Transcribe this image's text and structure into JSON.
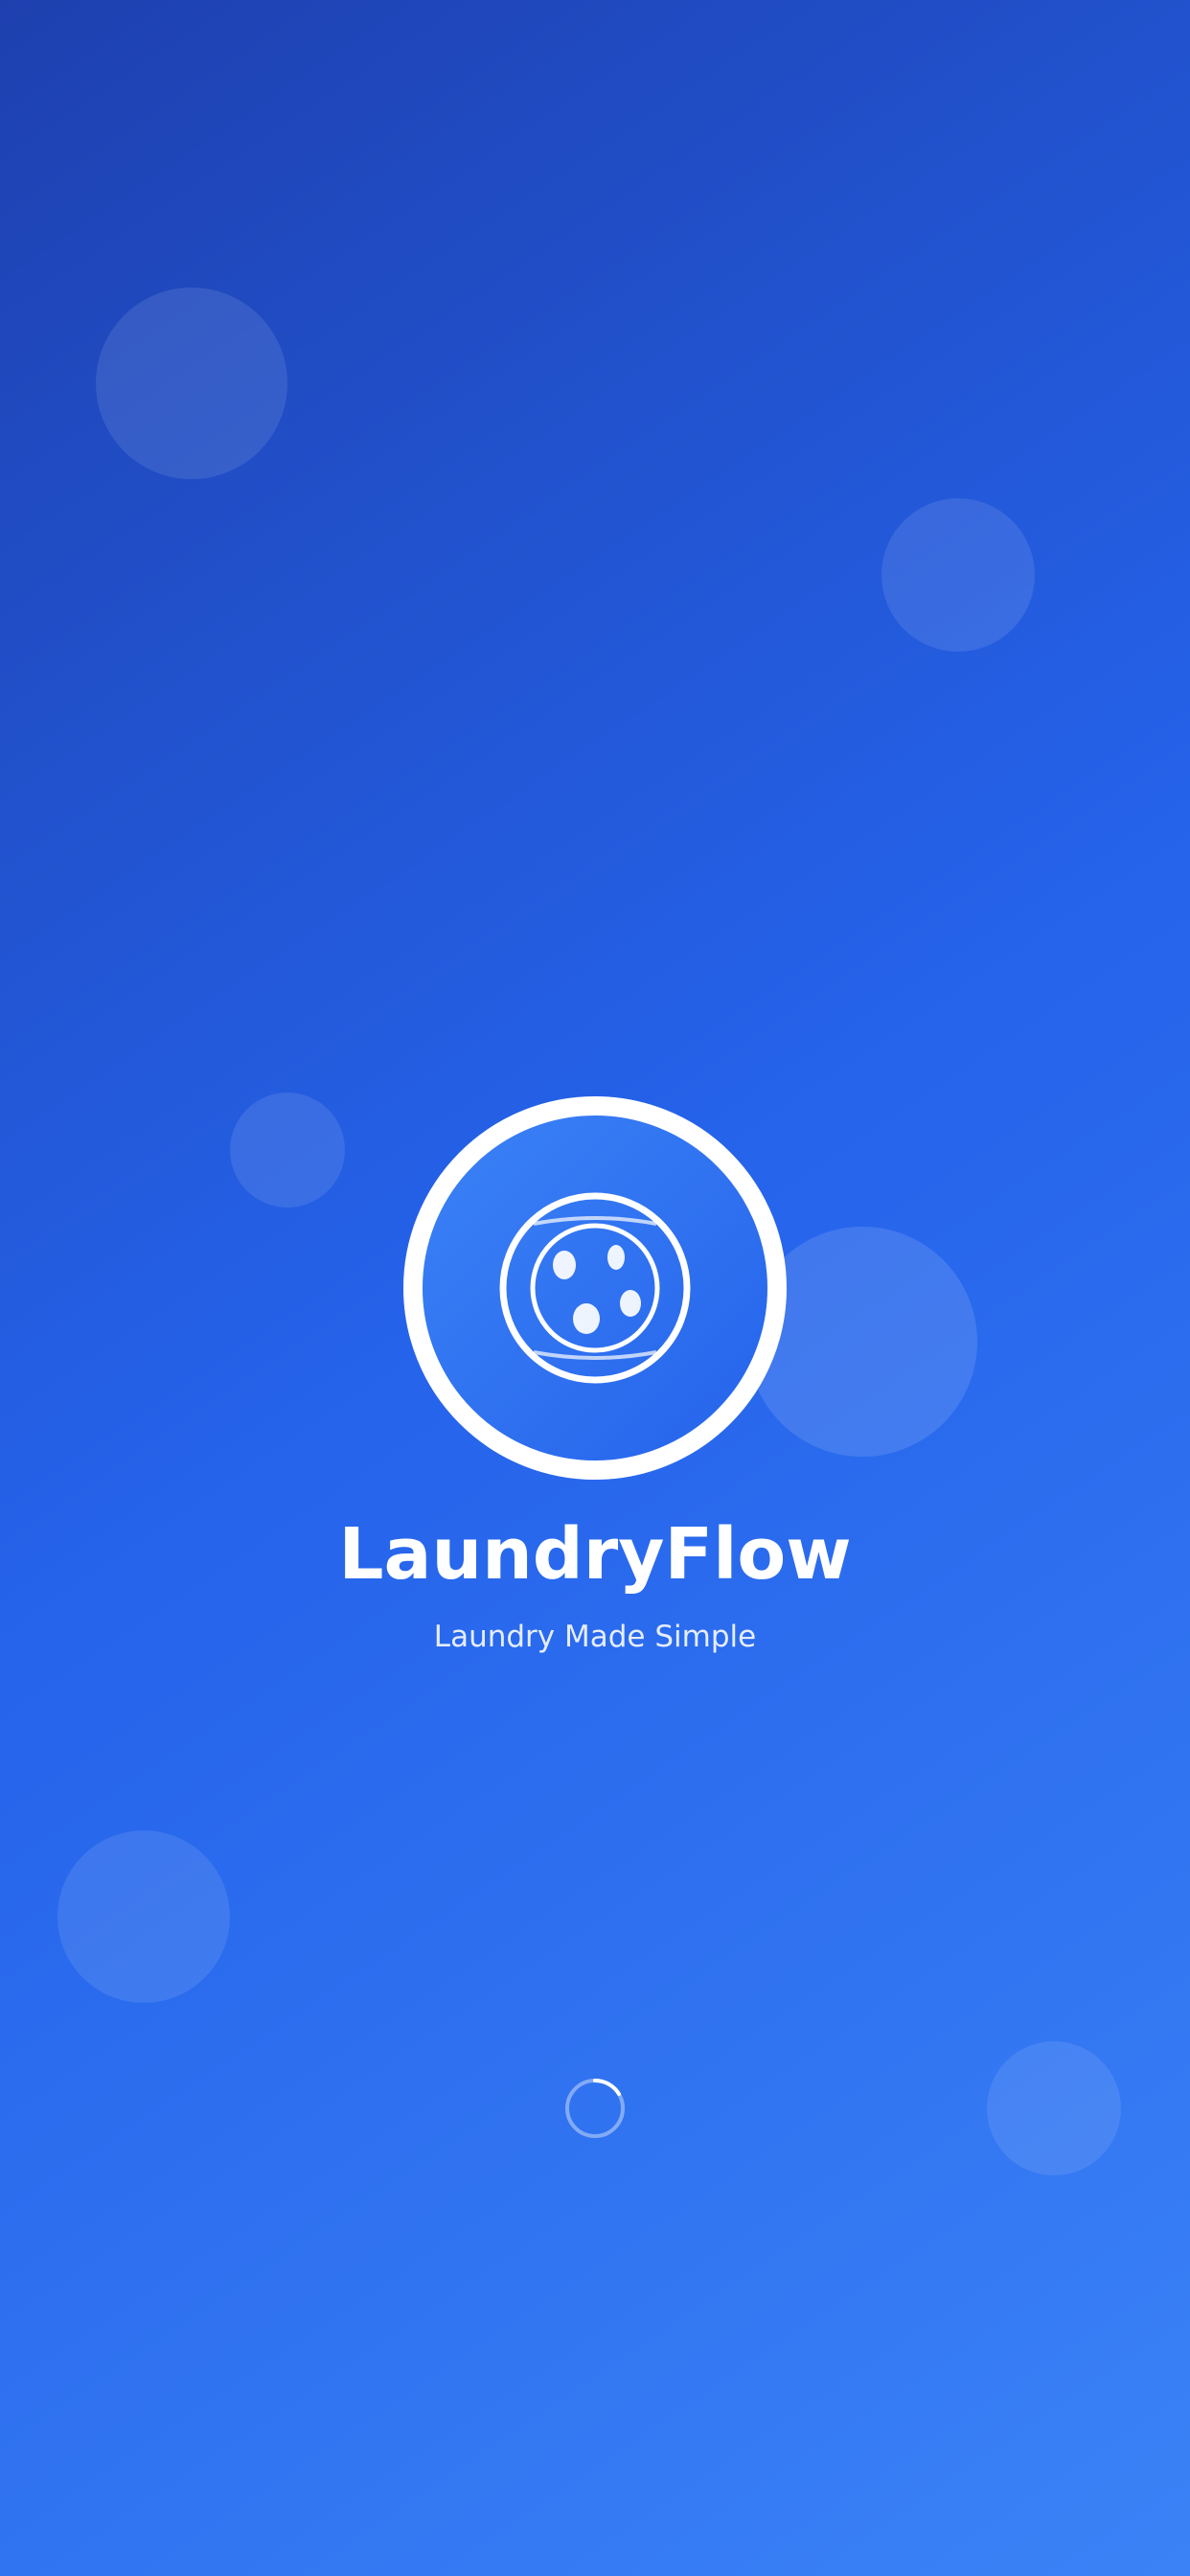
{
  "app": {
    "name": "LaundryFlow",
    "tagline": "Laundry Made Simple"
  },
  "logo": {
    "icon": "washing-machine-icon"
  },
  "loading": {
    "icon": "loading-spinner-icon"
  },
  "decorations": {
    "icon": "bubble"
  },
  "colors": {
    "gradient_start": "#1e40af",
    "gradient_mid": "#2563eb",
    "gradient_end": "#3b82f6",
    "logo_ring": "#ffffff",
    "text": "#ffffff"
  }
}
